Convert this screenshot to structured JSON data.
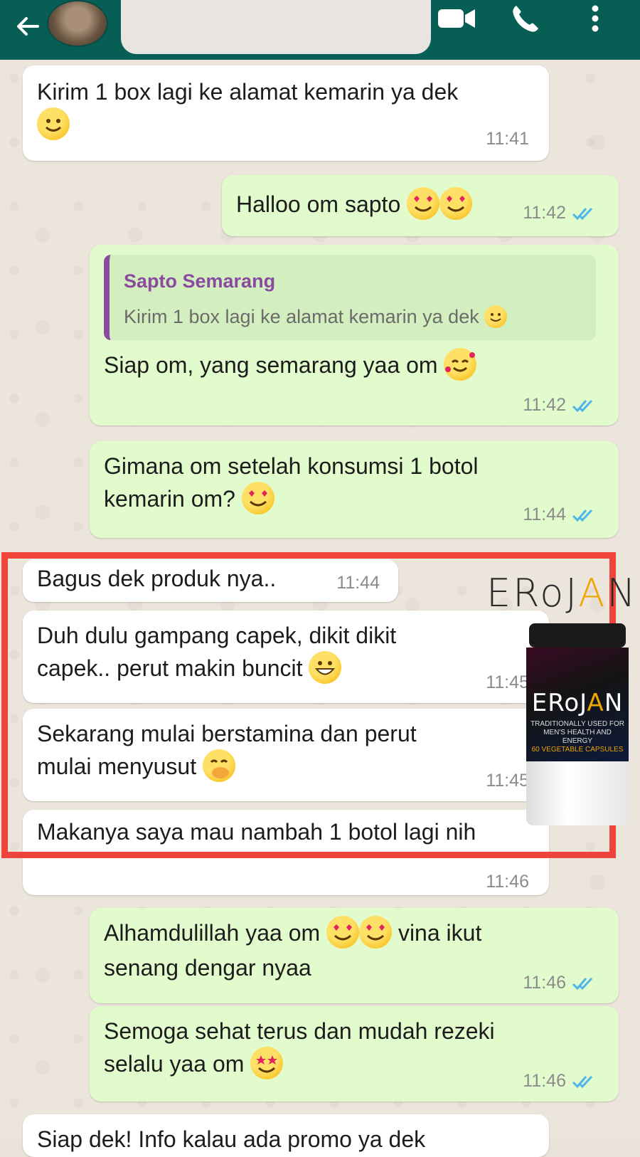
{
  "chat": {
    "contact_quote_name": "Sapto Semarang",
    "messages": [
      {
        "dir": "in",
        "text": "Kirim 1 box lagi ke alamat kemarin ya dek",
        "time": "11:41"
      },
      {
        "dir": "out",
        "text": "Halloo om sapto",
        "time": "11:42"
      },
      {
        "dir": "out",
        "quote_name": "Sapto Semarang",
        "quote_text": "Kirim 1 box lagi ke alamat kemarin ya dek",
        "text": "Siap om, yang semarang yaa om",
        "time": "11:42"
      },
      {
        "dir": "out",
        "text": "Gimana om setelah konsumsi 1 botol kemarin om?",
        "time": "11:44"
      },
      {
        "dir": "in",
        "text": "Bagus dek produk nya..",
        "time": "11:44"
      },
      {
        "dir": "in",
        "text": "Duh dulu gampang capek, dikit dikit capek.. perut makin buncit",
        "time": "11:45"
      },
      {
        "dir": "in",
        "text": "Sekarang mulai berstamina dan perut mulai menyusut",
        "time": "11:45"
      },
      {
        "dir": "in",
        "text": "Makanya saya mau nambah 1 botol lagi nih",
        "time": "11:46"
      },
      {
        "dir": "out",
        "text_a": "Alhamdulillah yaa om",
        "text_b": "vina ikut senang dengar nyaa",
        "time": "11:46"
      },
      {
        "dir": "out",
        "text": "Semoga sehat terus dan mudah rezeki selalu yaa om",
        "time": "11:46"
      },
      {
        "dir": "in",
        "text": "Siap dek! Info kalau ada promo ya dek"
      }
    ]
  },
  "overlay": {
    "brand": "EROJAN",
    "brand_main": "ERoJ",
    "brand_accent": "A",
    "brand_end": "N",
    "jar_sub": "TRADITIONALLY USED FOR MEN'S HEALTH AND ENERGY",
    "jar_count": "60 VEGETABLE CAPSULES"
  },
  "colors": {
    "header": "#075e54",
    "incoming": "#ffffff",
    "outgoing": "#e2fbcd",
    "highlight_frame": "#f0433a",
    "read_ticks": "#4fb6ec"
  },
  "icons": [
    "back-arrow-icon",
    "video-call-icon",
    "phone-call-icon",
    "more-options-icon",
    "double-check-icon",
    "emoji-icon"
  ]
}
